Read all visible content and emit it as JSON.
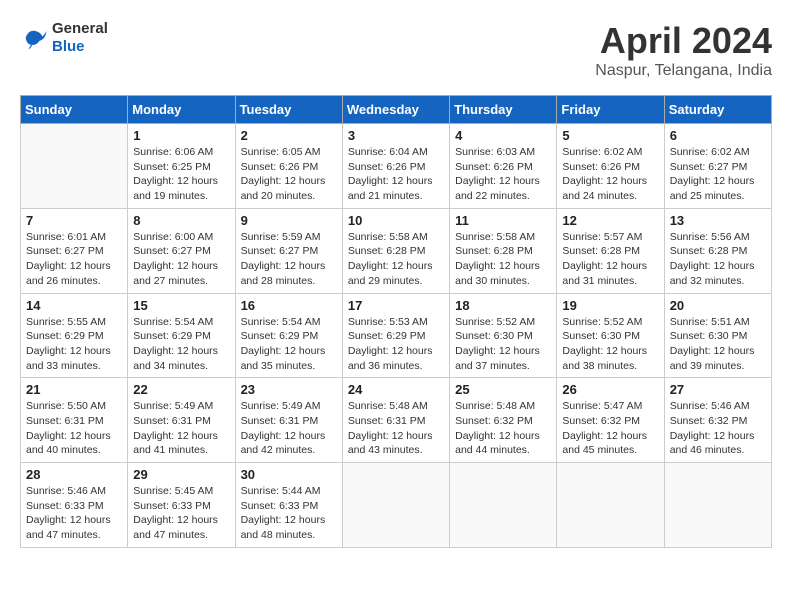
{
  "header": {
    "logo_line1": "General",
    "logo_line2": "Blue",
    "month": "April 2024",
    "location": "Naspur, Telangana, India"
  },
  "days_of_week": [
    "Sunday",
    "Monday",
    "Tuesday",
    "Wednesday",
    "Thursday",
    "Friday",
    "Saturday"
  ],
  "weeks": [
    [
      {
        "day": "",
        "info": ""
      },
      {
        "day": "1",
        "info": "Sunrise: 6:06 AM\nSunset: 6:25 PM\nDaylight: 12 hours\nand 19 minutes."
      },
      {
        "day": "2",
        "info": "Sunrise: 6:05 AM\nSunset: 6:26 PM\nDaylight: 12 hours\nand 20 minutes."
      },
      {
        "day": "3",
        "info": "Sunrise: 6:04 AM\nSunset: 6:26 PM\nDaylight: 12 hours\nand 21 minutes."
      },
      {
        "day": "4",
        "info": "Sunrise: 6:03 AM\nSunset: 6:26 PM\nDaylight: 12 hours\nand 22 minutes."
      },
      {
        "day": "5",
        "info": "Sunrise: 6:02 AM\nSunset: 6:26 PM\nDaylight: 12 hours\nand 24 minutes."
      },
      {
        "day": "6",
        "info": "Sunrise: 6:02 AM\nSunset: 6:27 PM\nDaylight: 12 hours\nand 25 minutes."
      }
    ],
    [
      {
        "day": "7",
        "info": "Sunrise: 6:01 AM\nSunset: 6:27 PM\nDaylight: 12 hours\nand 26 minutes."
      },
      {
        "day": "8",
        "info": "Sunrise: 6:00 AM\nSunset: 6:27 PM\nDaylight: 12 hours\nand 27 minutes."
      },
      {
        "day": "9",
        "info": "Sunrise: 5:59 AM\nSunset: 6:27 PM\nDaylight: 12 hours\nand 28 minutes."
      },
      {
        "day": "10",
        "info": "Sunrise: 5:58 AM\nSunset: 6:28 PM\nDaylight: 12 hours\nand 29 minutes."
      },
      {
        "day": "11",
        "info": "Sunrise: 5:58 AM\nSunset: 6:28 PM\nDaylight: 12 hours\nand 30 minutes."
      },
      {
        "day": "12",
        "info": "Sunrise: 5:57 AM\nSunset: 6:28 PM\nDaylight: 12 hours\nand 31 minutes."
      },
      {
        "day": "13",
        "info": "Sunrise: 5:56 AM\nSunset: 6:28 PM\nDaylight: 12 hours\nand 32 minutes."
      }
    ],
    [
      {
        "day": "14",
        "info": "Sunrise: 5:55 AM\nSunset: 6:29 PM\nDaylight: 12 hours\nand 33 minutes."
      },
      {
        "day": "15",
        "info": "Sunrise: 5:54 AM\nSunset: 6:29 PM\nDaylight: 12 hours\nand 34 minutes."
      },
      {
        "day": "16",
        "info": "Sunrise: 5:54 AM\nSunset: 6:29 PM\nDaylight: 12 hours\nand 35 minutes."
      },
      {
        "day": "17",
        "info": "Sunrise: 5:53 AM\nSunset: 6:29 PM\nDaylight: 12 hours\nand 36 minutes."
      },
      {
        "day": "18",
        "info": "Sunrise: 5:52 AM\nSunset: 6:30 PM\nDaylight: 12 hours\nand 37 minutes."
      },
      {
        "day": "19",
        "info": "Sunrise: 5:52 AM\nSunset: 6:30 PM\nDaylight: 12 hours\nand 38 minutes."
      },
      {
        "day": "20",
        "info": "Sunrise: 5:51 AM\nSunset: 6:30 PM\nDaylight: 12 hours\nand 39 minutes."
      }
    ],
    [
      {
        "day": "21",
        "info": "Sunrise: 5:50 AM\nSunset: 6:31 PM\nDaylight: 12 hours\nand 40 minutes."
      },
      {
        "day": "22",
        "info": "Sunrise: 5:49 AM\nSunset: 6:31 PM\nDaylight: 12 hours\nand 41 minutes."
      },
      {
        "day": "23",
        "info": "Sunrise: 5:49 AM\nSunset: 6:31 PM\nDaylight: 12 hours\nand 42 minutes."
      },
      {
        "day": "24",
        "info": "Sunrise: 5:48 AM\nSunset: 6:31 PM\nDaylight: 12 hours\nand 43 minutes."
      },
      {
        "day": "25",
        "info": "Sunrise: 5:48 AM\nSunset: 6:32 PM\nDaylight: 12 hours\nand 44 minutes."
      },
      {
        "day": "26",
        "info": "Sunrise: 5:47 AM\nSunset: 6:32 PM\nDaylight: 12 hours\nand 45 minutes."
      },
      {
        "day": "27",
        "info": "Sunrise: 5:46 AM\nSunset: 6:32 PM\nDaylight: 12 hours\nand 46 minutes."
      }
    ],
    [
      {
        "day": "28",
        "info": "Sunrise: 5:46 AM\nSunset: 6:33 PM\nDaylight: 12 hours\nand 47 minutes."
      },
      {
        "day": "29",
        "info": "Sunrise: 5:45 AM\nSunset: 6:33 PM\nDaylight: 12 hours\nand 47 minutes."
      },
      {
        "day": "30",
        "info": "Sunrise: 5:44 AM\nSunset: 6:33 PM\nDaylight: 12 hours\nand 48 minutes."
      },
      {
        "day": "",
        "info": ""
      },
      {
        "day": "",
        "info": ""
      },
      {
        "day": "",
        "info": ""
      },
      {
        "day": "",
        "info": ""
      }
    ]
  ]
}
